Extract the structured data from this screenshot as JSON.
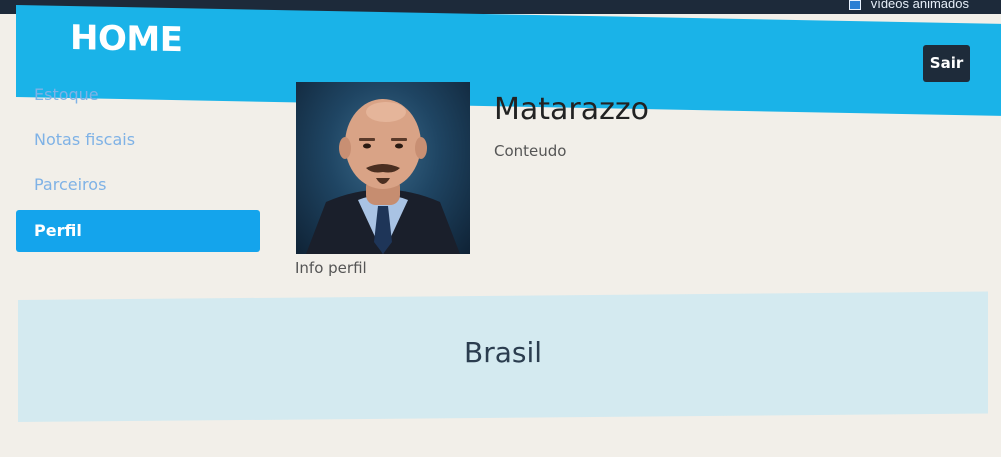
{
  "top_bar": {
    "checkbox_label": "vídeos animados"
  },
  "header": {
    "brand": "HOME",
    "logout_label": "Sair"
  },
  "sidebar": {
    "items": [
      {
        "label": "Estoque",
        "active": false
      },
      {
        "label": "Notas fiscais",
        "active": false
      },
      {
        "label": "Parceiros",
        "active": false
      },
      {
        "label": "Perfil",
        "active": true
      }
    ]
  },
  "profile": {
    "name": "Matarazzo",
    "content": "Conteudo",
    "photo_caption": "Info perfil"
  },
  "footer": {
    "country": "Brasil"
  },
  "colors": {
    "header_bg": "#1ab3e8",
    "active_item_bg": "#14a4ec",
    "logout_bg": "#1e2b3a",
    "footer_bg": "#d4eaf0"
  }
}
